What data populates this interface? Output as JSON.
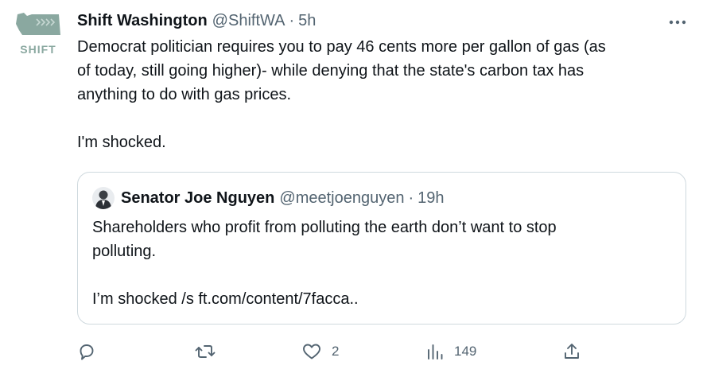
{
  "tweet": {
    "avatar_label": "SHIFT",
    "author_name": "Shift Washington",
    "author_handle": "@ShiftWA",
    "separator": "·",
    "time": "5h",
    "text_lines": [
      "Democrat politician requires you to pay 46 cents more per gallon of gas (as",
      "of today, still going higher)- while denying that the state's carbon tax has",
      "anything to do with gas prices."
    ],
    "text_line2": "I'm shocked."
  },
  "quote": {
    "author_name": "Senator Joe Nguyen",
    "author_handle": "@meetjoenguyen",
    "separator": "·",
    "time": "19h",
    "text_lines": [
      "Shareholders who profit from polluting the earth don’t want to stop",
      "polluting."
    ],
    "text_line2": "I’m shocked /s ft.com/content/7facca.."
  },
  "actions": {
    "reply": {
      "icon": "reply-icon",
      "count": ""
    },
    "retweet": {
      "icon": "retweet-icon",
      "count": ""
    },
    "like": {
      "icon": "heart-icon",
      "count": "2"
    },
    "views": {
      "icon": "views-icon",
      "count": "149"
    },
    "share": {
      "icon": "share-icon",
      "count": ""
    }
  },
  "colors": {
    "text_primary": "#0f1419",
    "text_secondary": "#536471",
    "border": "#cfd9de",
    "logo": "#8aa8a0"
  }
}
